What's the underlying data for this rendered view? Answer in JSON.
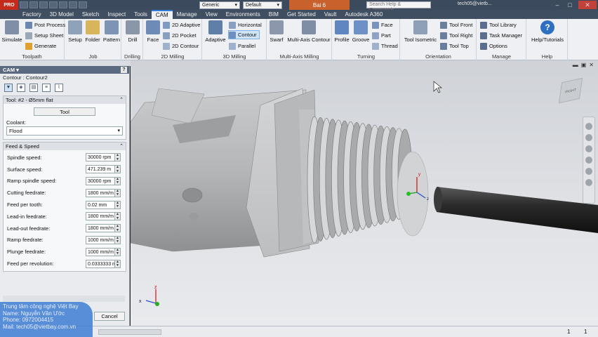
{
  "titlebar": {
    "app_logo": "PRO",
    "material_combo": "Generic",
    "appearance_combo": "Default",
    "document_title": "Bai 6",
    "search_placeholder": "Search Help & Commands...",
    "user": "tech05@vietb..."
  },
  "ribbon_tabs": [
    "Factory",
    "3D Model",
    "Sketch",
    "Inspect",
    "Tools",
    "CAM",
    "Manage",
    "View",
    "Environments",
    "BIM",
    "Get Started",
    "Vault",
    "Autodesk A360"
  ],
  "active_tab": "CAM",
  "ribbon": {
    "toolpath": {
      "label": "Toolpath",
      "simulate": "Simulate",
      "post_process": "Post Process",
      "setup_sheet": "Setup Sheet",
      "generate": "Generate"
    },
    "job": {
      "label": "Job",
      "setup": "Setup",
      "folder": "Folder",
      "pattern": "Pattern"
    },
    "drilling": {
      "label": "Drilling",
      "drill": "Drill"
    },
    "milling2d": {
      "label": "2D Milling",
      "face": "Face",
      "adaptive": "2D Adaptive",
      "pocket": "2D Pocket",
      "contour": "2D Contour"
    },
    "milling3d": {
      "label": "3D Milling",
      "adaptive": "Adaptive",
      "horizontal": "Horizontal",
      "contour": "Contour",
      "parallel": "Parallel"
    },
    "multiaxis": {
      "label": "Multi-Axis Milling",
      "swarf": "Swarf",
      "multi_axis_contour": "Multi-Axis Contour"
    },
    "turning": {
      "label": "Turning",
      "profile": "Profile",
      "groove": "Groove",
      "face": "Face",
      "part": "Part",
      "thread": "Thread"
    },
    "orientation": {
      "label": "Orientation",
      "tool_isometric": "Tool Isometric",
      "tool_front": "Tool Front",
      "tool_right": "Tool Right",
      "tool_top": "Tool Top"
    },
    "manage": {
      "label": "Manage",
      "tool_library": "Tool Library",
      "task_manager": "Task Manager",
      "options": "Options"
    },
    "help": {
      "label": "Help",
      "help_tutorials": "Help/Tutorials"
    }
  },
  "cam_panel": {
    "title": "CAM",
    "breadcrumb": "Contour : Contour2",
    "tool_section": {
      "title": "Tool: #2 - Ø5mm flat",
      "tool_button": "Tool",
      "coolant_label": "Coolant:",
      "coolant_value": "Flood"
    },
    "feed_section": {
      "title": "Feed & Speed",
      "fields": [
        {
          "label": "Spindle speed:",
          "value": "30000 rpm"
        },
        {
          "label": "Surface speed:",
          "value": "471.239 m"
        },
        {
          "label": "Ramp spindle speed:",
          "value": "30000 rpm"
        },
        {
          "label": "Cutting feedrate:",
          "value": "1800 mm/m"
        },
        {
          "label": "Feed per tooth:",
          "value": "0.02 mm"
        },
        {
          "label": "Lead-in feedrate:",
          "value": "1800 mm/m"
        },
        {
          "label": "Lead-out feedrate:",
          "value": "1800 mm/m"
        },
        {
          "label": "Ramp feedrate:",
          "value": "1000 mm/m"
        },
        {
          "label": "Plunge feedrate:",
          "value": "1000 mm/m"
        },
        {
          "label": "Feed per revolution:",
          "value": "0.0333333 m"
        }
      ]
    },
    "cancel_label": "Cancel"
  },
  "viewport": {
    "viewcube_label": "RIGHT",
    "axis_x": "x",
    "axis_y": "y",
    "axis_z": "z"
  },
  "statusbar": {
    "left_count": "1",
    "right_count": "1"
  },
  "watermark": {
    "line1": "Trung tâm công nghệ Việt Bay",
    "line2": "Name: Nguyễn Văn Ước",
    "line3": "Phone: 0972004415",
    "line4": "Mail: tech05@vietbay.com.vn"
  }
}
